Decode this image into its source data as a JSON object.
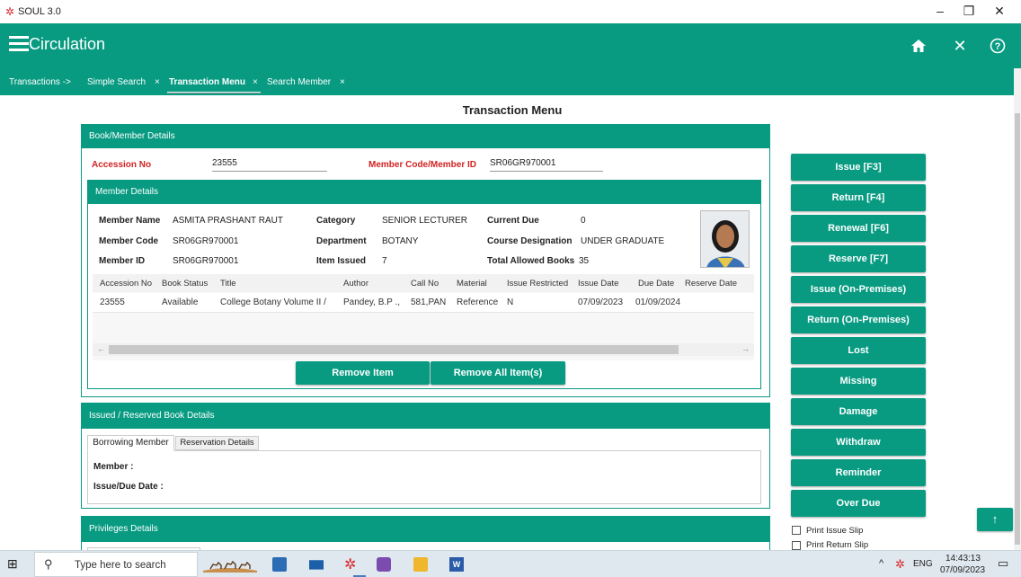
{
  "titlebar": {
    "app_name": "SOUL 3.0",
    "logo_glyph": "✲",
    "minimize": "–",
    "maximize": "❐",
    "close": "✕"
  },
  "appbar": {
    "title": "Circulation",
    "home_glyph": "⌂",
    "close_glyph": "✕",
    "help_glyph": "?"
  },
  "tabs": {
    "prefix": "Transactions ->",
    "items": [
      {
        "label": "Simple Search",
        "close": "×"
      },
      {
        "label": "Transaction Menu",
        "close": "×"
      },
      {
        "label": "Search Member",
        "close": "×"
      }
    ]
  },
  "page_title": "Transaction Menu",
  "book_member": {
    "header": "Book/Member Details",
    "accession_label": "Accession No",
    "accession_value": "23555",
    "member_code_label": "Member Code/Member ID",
    "member_code_value": "SR06GR970001"
  },
  "member_details": {
    "header": "Member Details",
    "fields": {
      "name_label": "Member Name",
      "name": "ASMITA PRASHANT  RAUT",
      "code_label": "Member Code",
      "code": "SR06GR970001",
      "id_label": "Member ID",
      "id": "SR06GR970001",
      "category_label": "Category",
      "category": "SENIOR LECTURER",
      "department_label": "Department",
      "department": "BOTANY",
      "issued_label": "Item Issued",
      "issued": "7",
      "due_label": "Current Due",
      "due": "0",
      "course_label": "Course Designation",
      "course": "UNDER GRADUATE",
      "allowed_label": "Total Allowed Books",
      "allowed": "35"
    },
    "table": {
      "headers": [
        "Accession No",
        "Book Status",
        "Title",
        "Author",
        "Call No",
        "Material",
        "Issue Restricted",
        "Issue Date",
        "Due Date",
        "Reserve Date"
      ],
      "rows": [
        [
          "23555",
          "Available",
          "College Botany Volume II /",
          "Pandey, B.P .,",
          "581,PAN",
          "Reference",
          "N",
          "07/09/2023",
          "01/09/2024",
          ""
        ]
      ]
    },
    "scroll_left": "←",
    "scroll_right": "→",
    "remove_item": "Remove Item",
    "remove_all": "Remove All Item(s)"
  },
  "issued_reserved": {
    "header": "Issued / Reserved Book Details",
    "tabs": [
      "Borrowing Member",
      "Reservation Details"
    ],
    "member_label": "Member :",
    "issue_due_label": "Issue/Due Date :"
  },
  "privileges": {
    "header": "Privileges Details"
  },
  "actions": [
    "Issue [F3]",
    "Return [F4]",
    "Renewal [F6]",
    "Reserve [F7]",
    "Issue (On-Premises)",
    "Return (On-Premises)",
    "Lost",
    "Missing",
    "Damage",
    "Withdraw",
    "Reminder",
    "Over Due"
  ],
  "print_options": {
    "issue_slip": "Print Issue Slip",
    "return_slip": "Print Return Slip"
  },
  "scroll_top_glyph": "↑",
  "taskbar": {
    "search_placeholder": "Type here to search",
    "lang": "ENG",
    "time": "14:43:13",
    "date": "07/09/2023",
    "tray_up": "^",
    "start_glyph": "⊞",
    "search_glyph": "⚲",
    "notif_glyph": "▭",
    "word_glyph": "W"
  },
  "colors": {
    "teal": "#089b82",
    "label_red": "#d32222"
  }
}
